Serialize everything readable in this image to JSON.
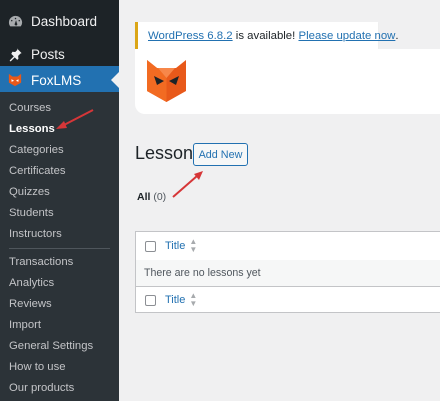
{
  "sidebar": {
    "dashboard_label": "Dashboard",
    "posts_label": "Posts",
    "foxlms_label": "FoxLMS",
    "submenu": [
      {
        "label": "Courses"
      },
      {
        "label": "Lessons"
      },
      {
        "label": "Categories"
      },
      {
        "label": "Certificates"
      },
      {
        "label": "Quizzes"
      },
      {
        "label": "Students"
      },
      {
        "label": "Instructors"
      },
      {
        "label": "Transactions"
      },
      {
        "label": "Analytics"
      },
      {
        "label": "Reviews"
      },
      {
        "label": "Import"
      },
      {
        "label": "General Settings"
      },
      {
        "label": "How to use"
      },
      {
        "label": "Our products"
      }
    ],
    "current_item": "Lessons"
  },
  "notice": {
    "version_link": "WordPress 6.8.2",
    "middle_text": " is available! ",
    "update_link": "Please update now",
    "end_text": "."
  },
  "header": {
    "page_title": "Lesson",
    "add_new_label": "Add New"
  },
  "views": {
    "all_label": "All",
    "all_count": "(0)"
  },
  "table": {
    "column_title": "Title",
    "empty_message": "There are no lessons yet",
    "footer_title": "Title"
  },
  "colors": {
    "sidebar_bg": "#1d2327",
    "submenu_bg": "#2c3338",
    "accent": "#2271b1",
    "foxlms_orange": "#e8591a",
    "annotation_arrow": "#d63638",
    "notice_border": "#dba617"
  },
  "icons": {
    "dashboard": "dashboard-icon",
    "posts": "pin-icon",
    "foxlms": "fox-logo-icon"
  }
}
